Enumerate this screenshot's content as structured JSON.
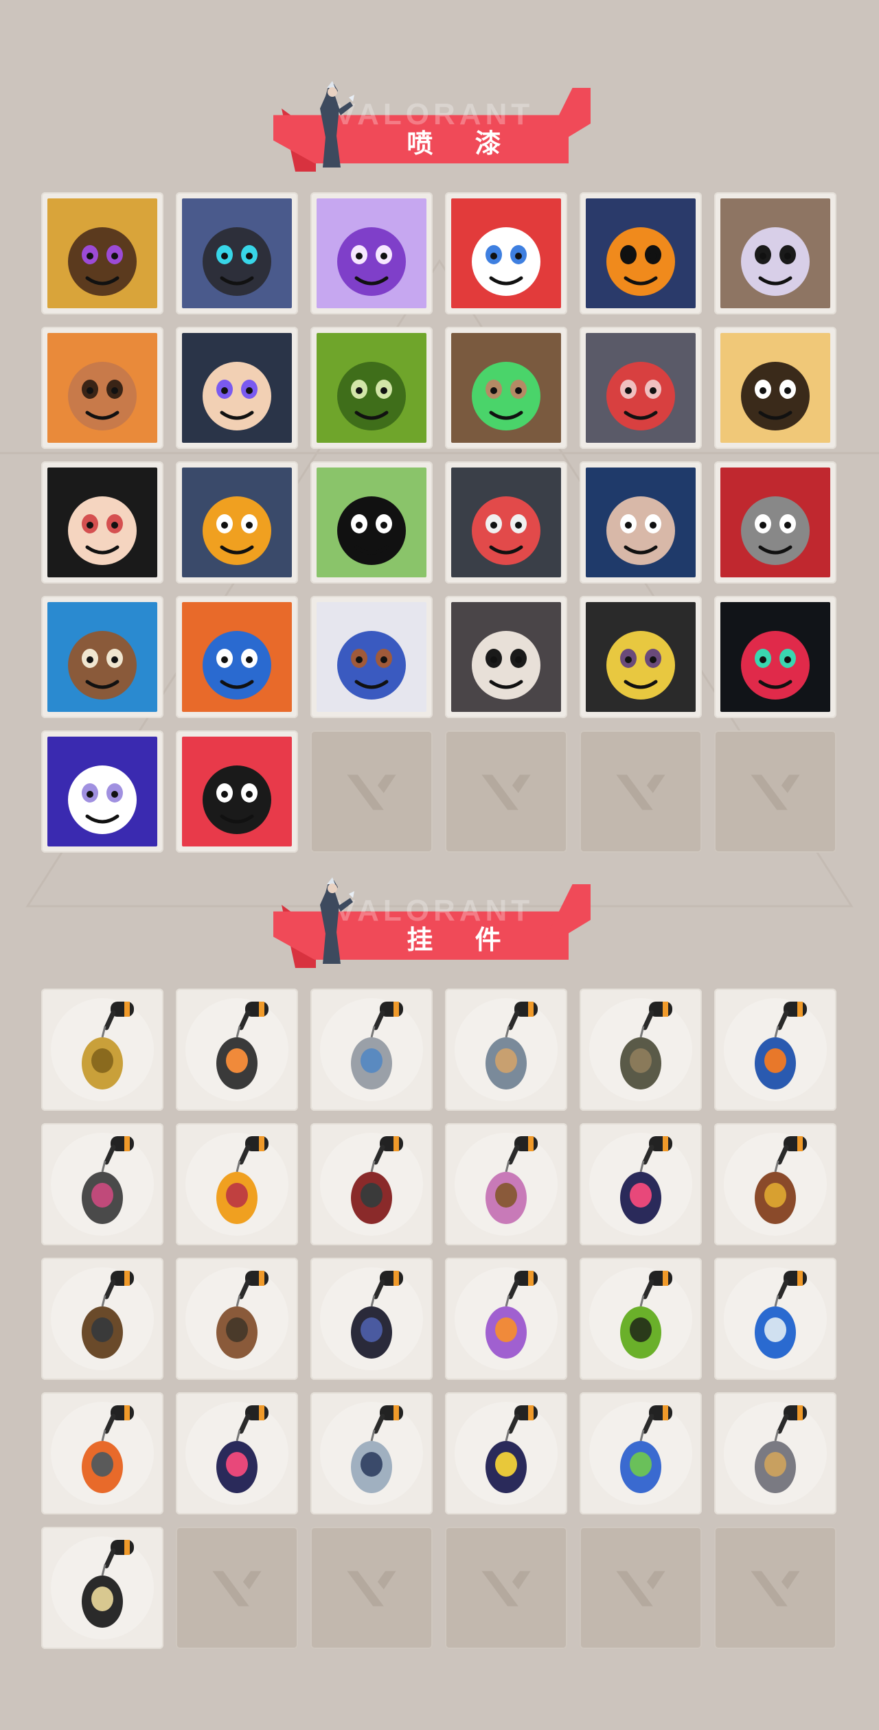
{
  "sections": [
    {
      "title": "喷 漆",
      "watermark": "VALORANT",
      "items": [
        {
          "kind": "spray",
          "name": "pixel-agent-spray",
          "colors": [
            "#d9a43a",
            "#5b3a1e",
            "#9c4bd6"
          ]
        },
        {
          "kind": "spray",
          "name": "robot-helmet-spray",
          "colors": [
            "#4a5a8c",
            "#2d2f3a",
            "#38d6e8"
          ]
        },
        {
          "kind": "spray",
          "name": "purple-heart-spray",
          "colors": [
            "#c6a7f0",
            "#7f3fc9",
            "#f6e8ff"
          ]
        },
        {
          "kind": "spray",
          "name": "clown-face-spray",
          "colors": [
            "#e23b3b",
            "#ffffff",
            "#3e7fe0"
          ]
        },
        {
          "kind": "spray",
          "name": "orange-top-hat-spray",
          "colors": [
            "#2a3a6a",
            "#f08a1c",
            "#111111"
          ]
        },
        {
          "kind": "spray",
          "name": "sunglasses-raccoon-spray",
          "colors": [
            "#8e7563",
            "#d8cfe8",
            "#1a1a1a"
          ]
        },
        {
          "kind": "spray",
          "name": "bearded-warrior-spray",
          "colors": [
            "#e98a3a",
            "#c87a4a",
            "#3a2416"
          ]
        },
        {
          "kind": "spray",
          "name": "anime-boy-spray",
          "colors": [
            "#2a3448",
            "#f2d0b4",
            "#7a5af0"
          ]
        },
        {
          "kind": "spray",
          "name": "green-box-spray",
          "colors": [
            "#6fa52b",
            "#3f6e1a",
            "#d3e6a8"
          ]
        },
        {
          "kind": "spray",
          "name": "green-eyes-creature-spray",
          "colors": [
            "#7a5a3f",
            "#4ad46a",
            "#b58a65"
          ]
        },
        {
          "kind": "spray",
          "name": "crying-beaver-spray",
          "colors": [
            "#5a5a68",
            "#d84040",
            "#f0c0c0"
          ]
        },
        {
          "kind": "spray",
          "name": "tiger-spray",
          "colors": [
            "#f0c878",
            "#3a2a1a",
            "#ffffff"
          ]
        },
        {
          "kind": "spray",
          "name": "angry-girl-spray",
          "colors": [
            "#1a1a1a",
            "#f5d5c0",
            "#d55050"
          ]
        },
        {
          "kind": "spray",
          "name": "penguin-beanie-spray",
          "colors": [
            "#3a4a6a",
            "#f0a020",
            "#ffffff"
          ]
        },
        {
          "kind": "spray",
          "name": "frog-hat-spray",
          "colors": [
            "#8ac46a",
            "#111111",
            "#ffffff"
          ]
        },
        {
          "kind": "spray",
          "name": "dark-cat-spray",
          "colors": [
            "#3a3f48",
            "#e24a4a",
            "#f0f0f0"
          ]
        },
        {
          "kind": "spray",
          "name": "hooded-agent-spray",
          "colors": [
            "#1f3a6a",
            "#d8b8a8",
            "#ffffff"
          ]
        },
        {
          "kind": "spray",
          "name": "red-x-button-spray",
          "colors": [
            "#c0282f",
            "#888888",
            "#ffffff"
          ]
        },
        {
          "kind": "spray",
          "name": "wave-bear-spray",
          "colors": [
            "#2a8ad0",
            "#8a5a3a",
            "#f0e6d0"
          ]
        },
        {
          "kind": "spray",
          "name": "koi-fish-spray",
          "colors": [
            "#e86a2a",
            "#2a6ad0",
            "#ffffff"
          ]
        },
        {
          "kind": "spray",
          "name": "armored-agent-spray",
          "colors": [
            "#e6e6ee",
            "#3a5ac0",
            "#a05a3a"
          ]
        },
        {
          "kind": "spray",
          "name": "catfish-spray",
          "colors": [
            "#4a4548",
            "#e8e0d8",
            "#1a1a1a"
          ]
        },
        {
          "kind": "spray",
          "name": "pistol-mask-spray",
          "colors": [
            "#2a2a2a",
            "#e8c840",
            "#6a4a7a"
          ]
        },
        {
          "kind": "spray",
          "name": "valorant-splatter-spray",
          "colors": [
            "#111418",
            "#e02a4a",
            "#3ad6b0"
          ]
        },
        {
          "kind": "spray",
          "name": "graffiti-tag-spray",
          "colors": [
            "#3a2ab0",
            "#ffffff",
            "#a090e0"
          ]
        },
        {
          "kind": "spray",
          "name": "red-valorant-logo-spray",
          "colors": [
            "#e83a4a",
            "#1a1a1a",
            "#ffffff"
          ]
        },
        {
          "kind": "empty"
        },
        {
          "kind": "empty"
        },
        {
          "kind": "empty"
        },
        {
          "kind": "empty"
        }
      ]
    },
    {
      "title": "挂 件",
      "watermark": "VALORANT",
      "items": [
        {
          "kind": "charm",
          "name": "gold-cat-charm",
          "colors": [
            "#c9a03a",
            "#8a6a1e"
          ]
        },
        {
          "kind": "charm",
          "name": "robot-drone-charm",
          "colors": [
            "#3a3a3a",
            "#f08a3a"
          ]
        },
        {
          "kind": "charm",
          "name": "bathtub-charm",
          "colors": [
            "#9aa0a8",
            "#5a8ac0"
          ]
        },
        {
          "kind": "charm",
          "name": "armored-animal-charm",
          "colors": [
            "#7a8a9a",
            "#c8a070"
          ]
        },
        {
          "kind": "charm",
          "name": "round-bag-charm",
          "colors": [
            "#5a5a48",
            "#8a7a5a"
          ]
        },
        {
          "kind": "charm",
          "name": "blue-canister-charm",
          "colors": [
            "#2a5ab0",
            "#e8782a"
          ]
        },
        {
          "kind": "charm",
          "name": "spiked-blade-charm",
          "colors": [
            "#4a4a4a",
            "#c04a7a"
          ]
        },
        {
          "kind": "charm",
          "name": "candy-corn-charm",
          "colors": [
            "#f0a020",
            "#c04040"
          ]
        },
        {
          "kind": "charm",
          "name": "braided-cord-charm",
          "colors": [
            "#8a2a2a",
            "#3a3a3a"
          ]
        },
        {
          "kind": "charm",
          "name": "cupcake-charm",
          "colors": [
            "#c87ab8",
            "#8a5a3a"
          ]
        },
        {
          "kind": "charm",
          "name": "ep9-medal-charm",
          "colors": [
            "#2a2a5a",
            "#e8487a"
          ]
        },
        {
          "kind": "charm",
          "name": "bear-bell-charm",
          "colors": [
            "#8a4a2a",
            "#d8a030"
          ]
        },
        {
          "kind": "charm",
          "name": "wooden-tool-charm",
          "colors": [
            "#6a4a2a",
            "#3a3a3a"
          ]
        },
        {
          "kind": "charm",
          "name": "crate-box-charm",
          "colors": [
            "#8a5a3a",
            "#4a3a2a"
          ]
        },
        {
          "kind": "charm",
          "name": "witch-figure-charm",
          "colors": [
            "#2a2a3a",
            "#4a5aa0"
          ]
        },
        {
          "kind": "charm",
          "name": "lava-lamp-charm",
          "colors": [
            "#a060d0",
            "#f08a3a"
          ]
        },
        {
          "kind": "charm",
          "name": "green-handheld-charm",
          "colors": [
            "#6ab02a",
            "#2a3a1a"
          ]
        },
        {
          "kind": "charm",
          "name": "blue-astronaut-charm",
          "colors": [
            "#2a6ad0",
            "#d0e0f0"
          ]
        },
        {
          "kind": "charm",
          "name": "radio-device-charm",
          "colors": [
            "#e86a2a",
            "#5a5a5a"
          ]
        },
        {
          "kind": "charm",
          "name": "ep9-medal-charm",
          "colors": [
            "#2a2a5a",
            "#e8487a"
          ]
        },
        {
          "kind": "charm",
          "name": "silver-agent-charm",
          "colors": [
            "#a0b0c0",
            "#3a4a6a"
          ]
        },
        {
          "kind": "charm",
          "name": "ep9-medal-charm",
          "colors": [
            "#2a2a5a",
            "#e8c83a"
          ]
        },
        {
          "kind": "charm",
          "name": "ufo-alien-charm",
          "colors": [
            "#3a6ad0",
            "#6ac05a"
          ]
        },
        {
          "kind": "charm",
          "name": "gray-creature-charm",
          "colors": [
            "#7a7a82",
            "#c8a060"
          ]
        },
        {
          "kind": "charm",
          "name": "valorant-token-charm",
          "colors": [
            "#2a2a2a",
            "#d8c890"
          ]
        },
        {
          "kind": "empty"
        },
        {
          "kind": "empty"
        },
        {
          "kind": "empty"
        },
        {
          "kind": "empty"
        },
        {
          "kind": "empty"
        }
      ]
    }
  ],
  "accent": "#f04a58"
}
